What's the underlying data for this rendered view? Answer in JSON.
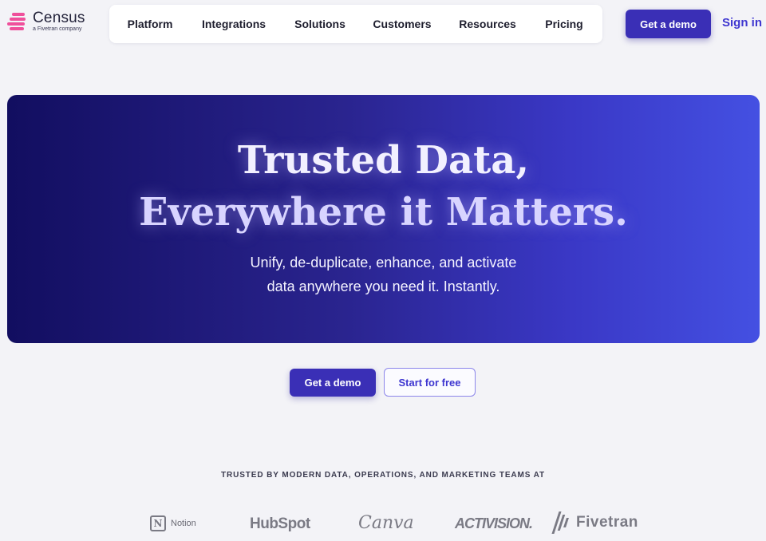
{
  "brand": {
    "name": "Census",
    "tagline": "a Fivetran company",
    "accent": "#ef4f9b"
  },
  "nav": {
    "items": [
      {
        "label": "Platform"
      },
      {
        "label": "Integrations"
      },
      {
        "label": "Solutions"
      },
      {
        "label": "Customers"
      },
      {
        "label": "Resources"
      },
      {
        "label": "Pricing"
      }
    ]
  },
  "header": {
    "demo_label": "Get a demo",
    "signin_label": "Sign in"
  },
  "hero": {
    "title_line1": "Trusted Data,",
    "title_line2": "Everywhere it Matters.",
    "subtitle_line1": "Unify, de-duplicate, enhance, and activate",
    "subtitle_line2": "data anywhere you need it. Instantly."
  },
  "cta": {
    "primary_label": "Get a demo",
    "secondary_label": "Start for free"
  },
  "trusted": {
    "heading": "TRUSTED BY MODERN DATA, OPERATIONS, AND MARKETING TEAMS AT",
    "logos": [
      {
        "name": "Notion",
        "icon_letter": "N"
      },
      {
        "name": "HubSpot"
      },
      {
        "name": "Canva"
      },
      {
        "name": "ACTIVISION."
      },
      {
        "name": "Fivetran"
      }
    ]
  },
  "colors": {
    "primary": "#3a2fb6",
    "link": "#3e36d0",
    "hero_start": "#120e60",
    "hero_end": "#4450e2"
  }
}
